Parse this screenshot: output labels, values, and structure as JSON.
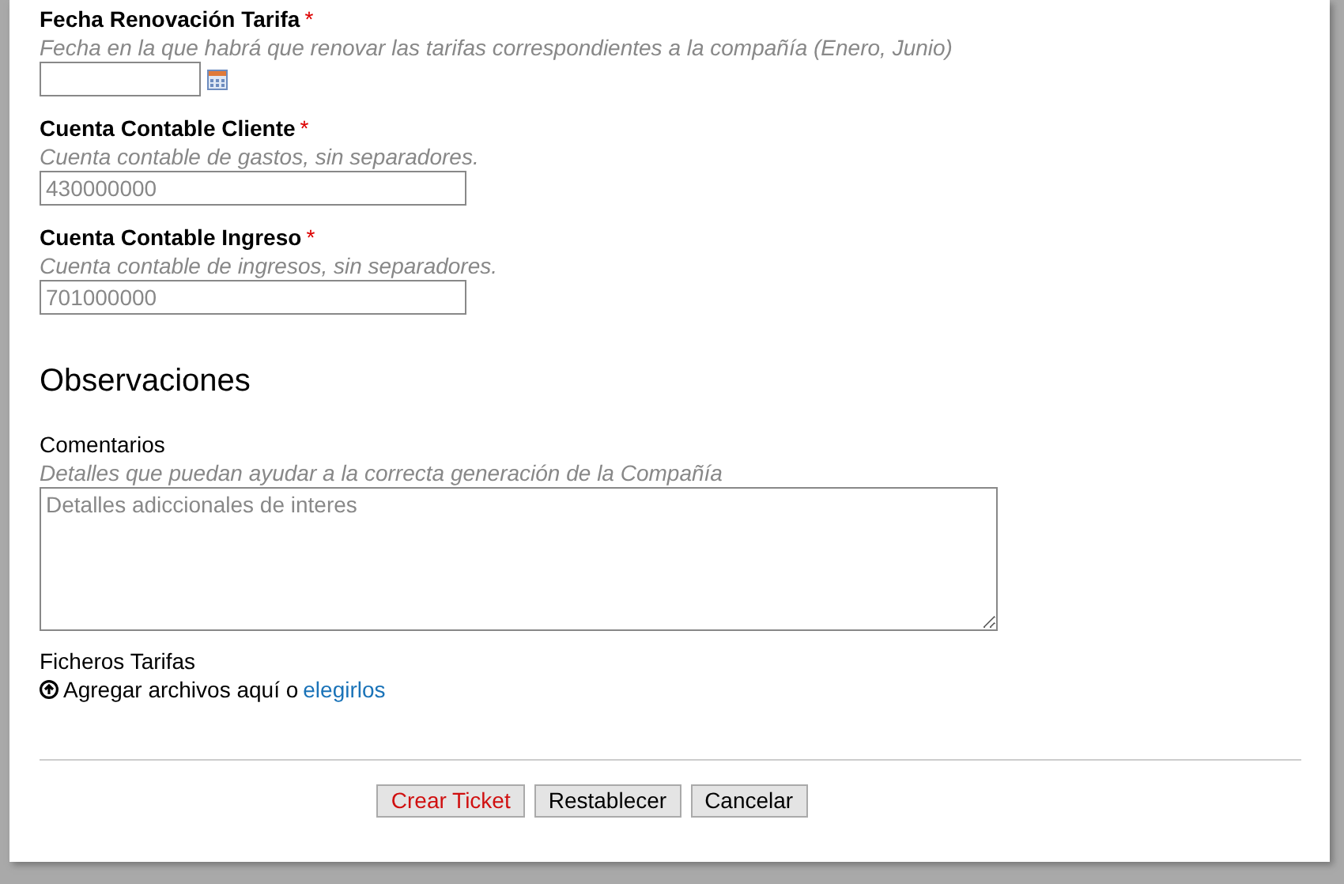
{
  "fields": [
    {
      "kind": "date",
      "label": "Fecha Renovación Tarifa",
      "required": true,
      "help": "Fecha en la que habrá que renovar las tarifas correspondientes a la compañía (Enero, Junio)"
    },
    {
      "kind": "text",
      "label": "Cuenta Contable Cliente",
      "required": true,
      "help": "Cuenta contable de gastos, sin separadores.",
      "placeholder": "430000000"
    },
    {
      "kind": "text",
      "label": "Cuenta Contable Ingreso",
      "required": true,
      "help": "Cuenta contable de ingresos, sin separadores.",
      "placeholder": "701000000"
    }
  ],
  "required_mark": "*",
  "section": {
    "title": "Observaciones"
  },
  "comments": {
    "label": "Comentarios",
    "help": "Detalles que puedan ayudar a la correcta generación de la Compañía",
    "placeholder": "Detalles adiccionales de interes"
  },
  "files": {
    "label": "Ficheros Tarifas",
    "drop_text": "Agregar archivos aquí o",
    "link": "elegirlos"
  },
  "buttons": [
    {
      "label": "Crear Ticket",
      "kind": "primary"
    },
    {
      "label": "Restablecer",
      "kind": "default"
    },
    {
      "label": "Cancelar",
      "kind": "default"
    }
  ]
}
